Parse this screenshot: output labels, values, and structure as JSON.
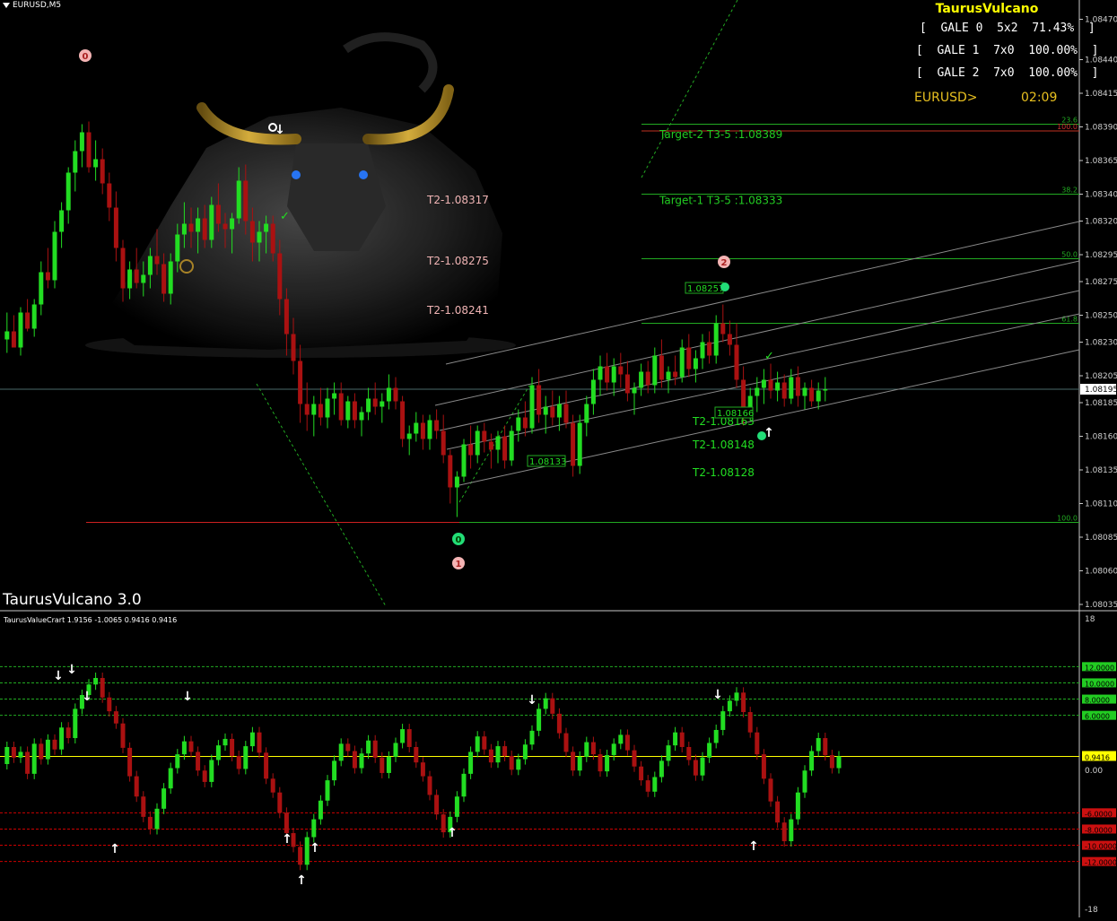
{
  "symbol_label": "EURUSD,M5",
  "brand_title": "TaurusVulcano",
  "indicator_name": "TaurusVulcano 3.0",
  "gale_stats": [
    "[  GALE 0  5x2  71.43%  ]",
    "[  GALE 1  7x0  100.00%  ]",
    "[  GALE 2  7x0  100.00%  ]"
  ],
  "pair_label": "EURUSD>",
  "timer": "02:09",
  "colors": {
    "bull": "#22dd22",
    "bear": "#aa1111",
    "fib": "#22aa22",
    "channel": "#8a8a8a",
    "accent": "#ffff00",
    "signal_red": "#cc0000"
  },
  "chart_data": [
    {
      "type": "candlestick",
      "symbol": "EURUSD",
      "timeframe": "M5",
      "ylim": [
        1.08035,
        1.08475
      ],
      "y_ticks": [
        1.0847,
        1.0844,
        1.08415,
        1.0839,
        1.08365,
        1.0834,
        1.0832,
        1.08295,
        1.08275,
        1.0825,
        1.0823,
        1.08205,
        1.08185,
        1.0816,
        1.08135,
        1.0811,
        1.08085,
        1.0806,
        1.08035
      ],
      "y_tick_labels": [
        "1.08470",
        "1.08440",
        "1.08415",
        "1.08390",
        "1.08365",
        "1.08340",
        "1.08320",
        "1.08295",
        "1.08275",
        "1.08250",
        "1.08230",
        "1.08205",
        "1.08185",
        "1.08160",
        "1.08135",
        "1.08110",
        "1.08085",
        "1.08060",
        "1.08035"
      ],
      "current_price": "1.08195",
      "fib_levels": [
        {
          "label": "23.6",
          "price": 1.08392
        },
        {
          "label": "100.0",
          "price": 1.08387
        },
        {
          "label": "38.2",
          "price": 1.0834
        },
        {
          "label": "50.0",
          "price": 1.08292
        },
        {
          "label": "61.8",
          "price": 1.08244
        },
        {
          "label": "100.0",
          "price": 1.08096
        }
      ],
      "targets": [
        {
          "text": "Target-2 T3-5 :1.08389",
          "price": 1.08389
        },
        {
          "text": "Target-1 T3-5 :1.08333",
          "price": 1.0834
        }
      ],
      "t2_labels_left": [
        "T2-1.08317",
        "T2-1.08275",
        "T2-1.08241"
      ],
      "t2_labels_right": [
        "T2-1.08163",
        "T2-1.08148",
        "T2-1.08128"
      ],
      "price_boxes": [
        "1.08257",
        "1.08166",
        "1.08133"
      ],
      "wave_markers": [
        {
          "label": "0",
          "style": "pink"
        },
        {
          "label": "2",
          "style": "pink"
        },
        {
          "label": "1",
          "style": "pink"
        },
        {
          "label": "0",
          "style": "green"
        }
      ],
      "candles": [
        [
          1.08232,
          1.08252,
          1.08222,
          1.08238
        ],
        [
          1.08238,
          1.0825,
          1.0823,
          1.08226
        ],
        [
          1.08226,
          1.08256,
          1.0822,
          1.08252
        ],
        [
          1.08252,
          1.08262,
          1.08238,
          1.0824
        ],
        [
          1.0824,
          1.08262,
          1.08234,
          1.08258
        ],
        [
          1.08258,
          1.0829,
          1.0825,
          1.08282
        ],
        [
          1.08282,
          1.083,
          1.0827,
          1.08276
        ],
        [
          1.08276,
          1.0832,
          1.0827,
          1.08312
        ],
        [
          1.08312,
          1.08334,
          1.083,
          1.08328
        ],
        [
          1.08328,
          1.0836,
          1.08318,
          1.08356
        ],
        [
          1.08356,
          1.0838,
          1.08342,
          1.08372
        ],
        [
          1.08372,
          1.08392,
          1.0836,
          1.08386
        ],
        [
          1.08386,
          1.08394,
          1.08356,
          1.0836
        ],
        [
          1.0836,
          1.0838,
          1.0835,
          1.08366
        ],
        [
          1.08366,
          1.08374,
          1.0834,
          1.08348
        ],
        [
          1.08348,
          1.08356,
          1.0832,
          1.0833
        ],
        [
          1.0833,
          1.08342,
          1.0829,
          1.083
        ],
        [
          1.083,
          1.08306,
          1.0826,
          1.0827
        ],
        [
          1.0827,
          1.0829,
          1.08262,
          1.08284
        ],
        [
          1.08284,
          1.083,
          1.0827,
          1.08274
        ],
        [
          1.08274,
          1.0829,
          1.08264,
          1.0828
        ],
        [
          1.0828,
          1.083,
          1.0827,
          1.08294
        ],
        [
          1.08294,
          1.08314,
          1.0828,
          1.08288
        ],
        [
          1.08288,
          1.08296,
          1.0826,
          1.08266
        ],
        [
          1.08266,
          1.08296,
          1.08258,
          1.0829
        ],
        [
          1.0829,
          1.08318,
          1.08282,
          1.0831
        ],
        [
          1.0831,
          1.08334,
          1.083,
          1.08318
        ],
        [
          1.08318,
          1.0833,
          1.083,
          1.08312
        ],
        [
          1.08312,
          1.0833,
          1.08296,
          1.08322
        ],
        [
          1.08322,
          1.08332,
          1.083,
          1.08306
        ],
        [
          1.08306,
          1.08338,
          1.083,
          1.08332
        ],
        [
          1.08332,
          1.08348,
          1.08312,
          1.08318
        ],
        [
          1.08318,
          1.08326,
          1.083,
          1.08314
        ],
        [
          1.08314,
          1.08326,
          1.08296,
          1.08322
        ],
        [
          1.08322,
          1.0836,
          1.08318,
          1.0835
        ],
        [
          1.0835,
          1.08362,
          1.0831,
          1.0832
        ],
        [
          1.0832,
          1.0833,
          1.0829,
          1.08304
        ],
        [
          1.08304,
          1.0832,
          1.0829,
          1.08312
        ],
        [
          1.08312,
          1.08324,
          1.08296,
          1.08318
        ],
        [
          1.08318,
          1.08324,
          1.0829,
          1.08296
        ],
        [
          1.08296,
          1.08306,
          1.0825,
          1.08262
        ],
        [
          1.08262,
          1.0827,
          1.0822,
          1.08236
        ],
        [
          1.08236,
          1.08248,
          1.08206,
          1.08216
        ],
        [
          1.08216,
          1.08228,
          1.0817,
          1.08184
        ],
        [
          1.08184,
          1.082,
          1.08164,
          1.08176
        ],
        [
          1.08176,
          1.0819,
          1.0816,
          1.08184
        ],
        [
          1.08184,
          1.08196,
          1.08168,
          1.08174
        ],
        [
          1.08174,
          1.08196,
          1.08166,
          1.08188
        ],
        [
          1.08188,
          1.082,
          1.08176,
          1.08192
        ],
        [
          1.08192,
          1.082,
          1.08168,
          1.08172
        ],
        [
          1.08172,
          1.0819,
          1.08166,
          1.08186
        ],
        [
          1.08186,
          1.08192,
          1.08166,
          1.08172
        ],
        [
          1.08172,
          1.08182,
          1.0816,
          1.08178
        ],
        [
          1.08178,
          1.08196,
          1.08172,
          1.08188
        ],
        [
          1.08188,
          1.082,
          1.08176,
          1.08182
        ],
        [
          1.08182,
          1.08192,
          1.0817,
          1.08186
        ],
        [
          1.08186,
          1.08206,
          1.0818,
          1.08196
        ],
        [
          1.08196,
          1.08204,
          1.0818,
          1.08186
        ],
        [
          1.08186,
          1.0819,
          1.08152,
          1.08158
        ],
        [
          1.08158,
          1.08168,
          1.08146,
          1.08162
        ],
        [
          1.08162,
          1.08178,
          1.08156,
          1.0817
        ],
        [
          1.0817,
          1.08176,
          1.0815,
          1.08158
        ],
        [
          1.08158,
          1.08176,
          1.0815,
          1.08172
        ],
        [
          1.08172,
          1.0818,
          1.08158,
          1.08164
        ],
        [
          1.08164,
          1.08176,
          1.0814,
          1.08146
        ],
        [
          1.08146,
          1.0815,
          1.0811,
          1.08122
        ],
        [
          1.08122,
          1.08134,
          1.081,
          1.0813
        ],
        [
          1.0813,
          1.08158,
          1.08126,
          1.08154
        ],
        [
          1.08154,
          1.08168,
          1.08136,
          1.08146
        ],
        [
          1.08146,
          1.08168,
          1.0814,
          1.08164
        ],
        [
          1.08164,
          1.0817,
          1.08148,
          1.08156
        ],
        [
          1.08156,
          1.08162,
          1.08136,
          1.0815
        ],
        [
          1.0815,
          1.08164,
          1.0814,
          1.0816
        ],
        [
          1.0816,
          1.08168,
          1.08136,
          1.08142
        ],
        [
          1.08142,
          1.08168,
          1.08138,
          1.08164
        ],
        [
          1.08164,
          1.0818,
          1.08156,
          1.08174
        ],
        [
          1.08174,
          1.08186,
          1.0816,
          1.08166
        ],
        [
          1.08166,
          1.08204,
          1.08162,
          1.08198
        ],
        [
          1.08198,
          1.0821,
          1.0817,
          1.08176
        ],
        [
          1.08176,
          1.0819,
          1.08162,
          1.08182
        ],
        [
          1.08182,
          1.08194,
          1.08168,
          1.08174
        ],
        [
          1.08174,
          1.0819,
          1.08164,
          1.08184
        ],
        [
          1.08184,
          1.08194,
          1.08166,
          1.0817
        ],
        [
          1.0817,
          1.08176,
          1.0813,
          1.08138
        ],
        [
          1.08138,
          1.08176,
          1.08132,
          1.0817
        ],
        [
          1.0817,
          1.0819,
          1.0816,
          1.08184
        ],
        [
          1.08184,
          1.0821,
          1.08176,
          1.08202
        ],
        [
          1.08202,
          1.0822,
          1.0819,
          1.08212
        ],
        [
          1.08212,
          1.08222,
          1.08194,
          1.082
        ],
        [
          1.082,
          1.08218,
          1.0819,
          1.08212
        ],
        [
          1.08212,
          1.08222,
          1.08196,
          1.08206
        ],
        [
          1.08206,
          1.08216,
          1.08186,
          1.08192
        ],
        [
          1.08192,
          1.082,
          1.08176,
          1.08196
        ],
        [
          1.08196,
          1.08214,
          1.0819,
          1.08208
        ],
        [
          1.08208,
          1.08216,
          1.08192,
          1.08198
        ],
        [
          1.08198,
          1.08226,
          1.08192,
          1.0822
        ],
        [
          1.0822,
          1.08232,
          1.08196,
          1.08202
        ],
        [
          1.08202,
          1.08212,
          1.08192,
          1.08208
        ],
        [
          1.08208,
          1.0822,
          1.08198,
          1.08204
        ],
        [
          1.08204,
          1.08232,
          1.082,
          1.08226
        ],
        [
          1.08226,
          1.08236,
          1.08204,
          1.0821
        ],
        [
          1.0821,
          1.08224,
          1.082,
          1.08218
        ],
        [
          1.08218,
          1.08236,
          1.0821,
          1.0823
        ],
        [
          1.0823,
          1.08238,
          1.08214,
          1.0822
        ],
        [
          1.0822,
          1.0825,
          1.08214,
          1.08244
        ],
        [
          1.08244,
          1.08258,
          1.0823,
          1.08236
        ],
        [
          1.08236,
          1.08246,
          1.0822,
          1.08228
        ],
        [
          1.08228,
          1.08244,
          1.08196,
          1.08202
        ],
        [
          1.08202,
          1.08212,
          1.08168,
          1.08176
        ],
        [
          1.08176,
          1.08196,
          1.08172,
          1.0819
        ],
        [
          1.0819,
          1.08204,
          1.08178,
          1.08196
        ],
        [
          1.08196,
          1.0821,
          1.08184,
          1.08202
        ],
        [
          1.08202,
          1.08214,
          1.08188,
          1.08194
        ],
        [
          1.08194,
          1.08208,
          1.08186,
          1.082
        ],
        [
          1.082,
          1.08206,
          1.08182,
          1.08188
        ],
        [
          1.08188,
          1.0821,
          1.08184,
          1.08204
        ],
        [
          1.08204,
          1.08212,
          1.08182,
          1.0819
        ],
        [
          1.0819,
          1.082,
          1.0818,
          1.08196
        ],
        [
          1.08196,
          1.08202,
          1.08182,
          1.08186
        ],
        [
          1.08186,
          1.082,
          1.0818,
          1.08194
        ],
        [
          1.08194,
          1.08204,
          1.08186,
          1.08195
        ]
      ]
    },
    {
      "type": "histogram",
      "title": "TaurusValueCrart 1.9156 -1.0065 0.9416 0.9416",
      "ylim": [
        -18,
        18
      ],
      "y_tick_labels": [
        "18",
        "0.00",
        "-18"
      ],
      "current_value": "0.9416",
      "upper_levels": [
        {
          "label": "12.0000",
          "value": 12
        },
        {
          "label": "10.0000",
          "value": 10
        },
        {
          "label": "8.0000",
          "value": 8
        },
        {
          "label": "6.0000",
          "value": 6
        }
      ],
      "lower_levels": [
        {
          "label": "-6.0000",
          "value": -6
        },
        {
          "label": "-8.0000",
          "value": -8
        },
        {
          "label": "-10.0000",
          "value": -10
        },
        {
          "label": "-12.0000",
          "value": -12
        }
      ],
      "values": [
        2.1,
        0.8,
        1.5,
        -1.2,
        2.5,
        0.6,
        3.0,
        1.8,
        4.5,
        3.2,
        6.8,
        8.5,
        9.8,
        10.6,
        8.2,
        6.5,
        5.0,
        2.0,
        -1.5,
        -4.0,
        -6.5,
        -8.0,
        -5.5,
        -3.0,
        -0.5,
        1.2,
        2.8,
        1.5,
        -0.8,
        -2.2,
        0.5,
        2.3,
        3.1,
        1.0,
        -0.6,
        2.2,
        3.9,
        1.4,
        -1.8,
        -3.5,
        -6.0,
        -8.5,
        -10.2,
        -12.4,
        -9.0,
        -6.8,
        -4.5,
        -2.0,
        0.4,
        2.5,
        1.6,
        -0.5,
        1.3,
        2.9,
        0.8,
        -1.1,
        0.9,
        2.6,
        4.3,
        2.1,
        0.2,
        -1.5,
        -3.8,
        -6.2,
        -8.4,
        -6.5,
        -4.0,
        -1.2,
        1.5,
        3.4,
        1.8,
        0.2,
        2.2,
        1.0,
        -0.7,
        0.6,
        2.4,
        4.1,
        6.8,
        8.1,
        6.2,
        3.8,
        1.5,
        -0.8,
        0.9,
        2.7,
        1.2,
        -0.9,
        1.1,
        2.5,
        3.6,
        1.7,
        -0.3,
        -2.0,
        -3.4,
        -1.6,
        0.4,
        2.3,
        3.9,
        2.1,
        0.5,
        -1.4,
        0.8,
        2.6,
        4.2,
        6.5,
        7.8,
        8.8,
        6.4,
        3.9,
        1.2,
        -1.8,
        -4.6,
        -7.2,
        -9.5,
        -6.8,
        -3.5,
        -0.8,
        1.6,
        3.2,
        1.1,
        -0.5,
        0.94
      ]
    }
  ]
}
